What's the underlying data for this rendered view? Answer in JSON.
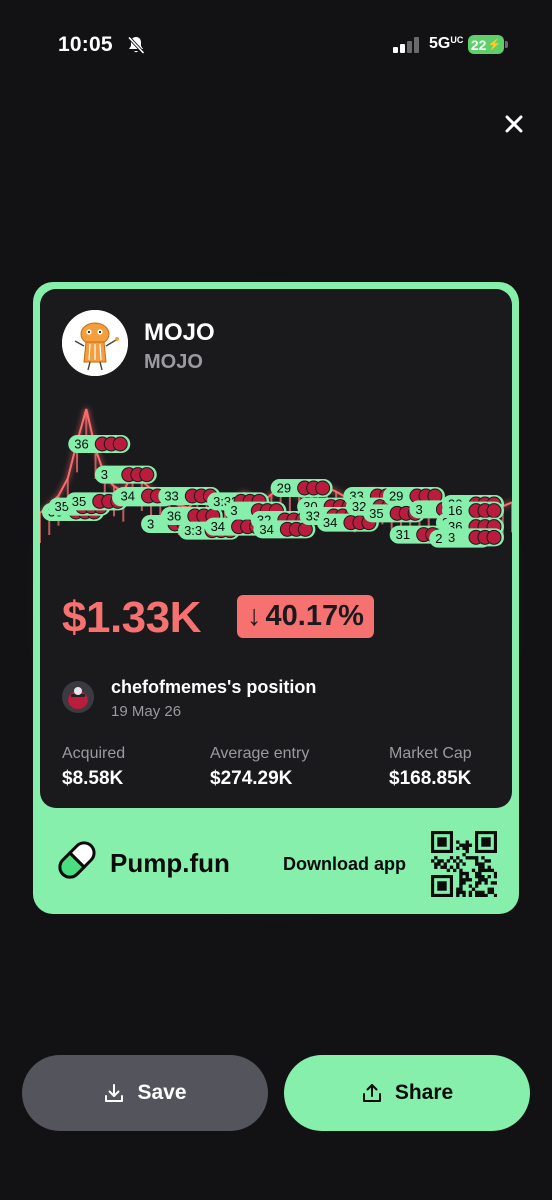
{
  "status_bar": {
    "time": "10:05",
    "network": "5G",
    "network_sup": "UC",
    "battery": "22"
  },
  "card": {
    "token": {
      "name": "MOJO",
      "symbol": "MOJO"
    },
    "value": "$1.33K",
    "change": {
      "arrow": "↓",
      "percent": "40.17%"
    },
    "position": {
      "label": "chefofmemes's position",
      "date": "19 May 26"
    },
    "stats": [
      {
        "label": "Acquired",
        "value": "$8.58K"
      },
      {
        "label": "Average entry",
        "value": "$274.29K"
      },
      {
        "label": "Market Cap",
        "value": "$168.85K"
      }
    ],
    "footer": {
      "brand": "Pump.fun",
      "download": "Download app"
    },
    "colors": {
      "accent_green": "#86efac",
      "loss_red": "#f87171",
      "card_bg": "#1a1a1d"
    }
  },
  "chart_data": {
    "type": "line",
    "title": "",
    "xlabel": "",
    "ylabel": "",
    "series": [
      {
        "values": [
          42,
          48,
          55,
          68,
          95,
          120,
          90,
          70,
          62,
          58,
          72,
          66,
          60,
          54,
          50,
          48,
          46,
          52,
          58,
          55,
          50,
          52,
          57,
          54,
          50,
          56,
          60,
          58,
          55,
          52,
          57,
          61,
          58,
          54,
          50,
          55,
          59,
          56,
          52,
          54,
          51,
          53,
          50,
          52,
          49,
          51,
          48,
          50,
          52,
          49,
          47,
          50
        ]
      }
    ],
    "trade_bubbles": [
      "36",
      "35",
      "35",
      "36",
      "3",
      "36",
      "34",
      "3",
      "33",
      "36",
      "3:3",
      "34",
      "3:32",
      "3",
      "32",
      "34",
      "29",
      "30",
      "33",
      "34",
      "33",
      "32",
      "35",
      "31",
      "29",
      "3",
      "28",
      "26",
      "30",
      "16",
      "36",
      "3"
    ]
  },
  "actions": {
    "save": "Save",
    "share": "Share"
  }
}
